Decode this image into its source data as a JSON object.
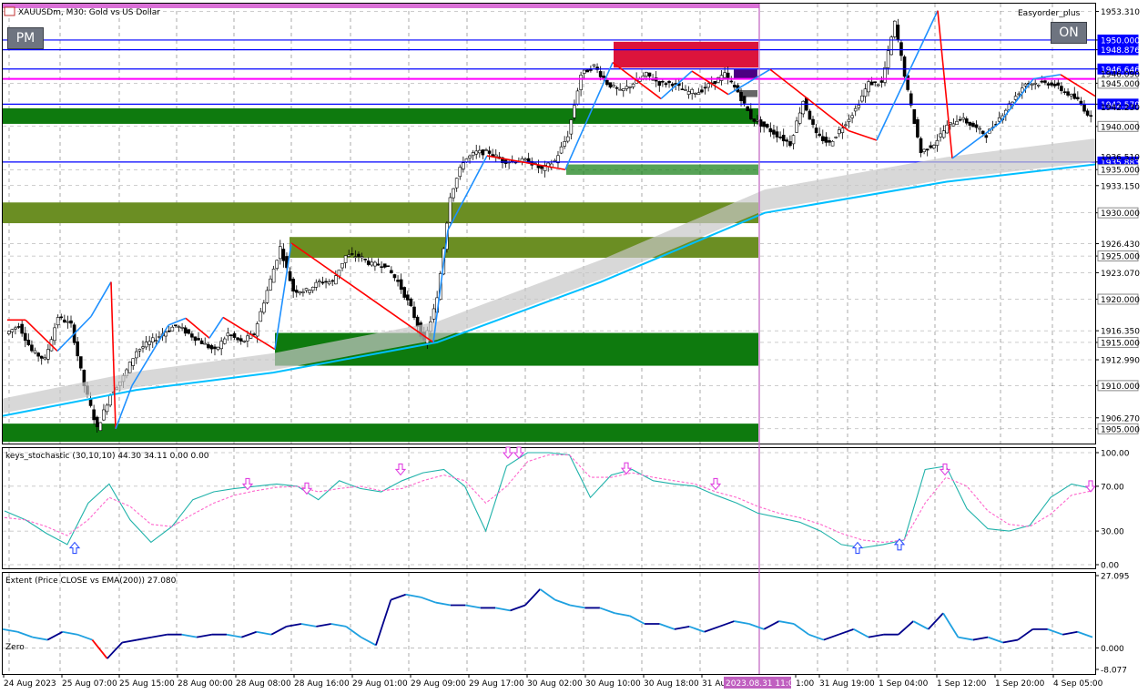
{
  "title": "XAUUSDm, M30:  Gold vs US Dollar",
  "expert_name": "Easyorder_plus",
  "buttons": {
    "pm": "PM",
    "on": "ON"
  },
  "colors": {
    "bull": "#0e7a0e",
    "olive": "#6b8e23",
    "supply": "#dc143c",
    "blue_line": "#0000ff",
    "magenta": "#ff00ff",
    "ema": "#00bfff",
    "zig_up": "#1e90ff",
    "zig_down": "#ff0000",
    "vline": "#c060c0"
  },
  "chart_data": [
    {
      "type": "candlestick",
      "title": "XAUUSDm, M30:  Gold vs US Dollar",
      "ylim": [
        1903.4,
        1954.0
      ],
      "price_ticks": [
        "1953.310",
        "1950.000",
        "1948.876",
        "1946.646",
        "1945.000",
        "1942.579",
        "1940.000",
        "1935.883",
        "1935.000",
        "1933.150",
        "1930.000",
        "1926.430",
        "1925.000",
        "1923.070",
        "1920.000",
        "1916.350",
        "1915.000",
        "1912.990",
        "1910.000",
        "1906.270",
        "1905.000"
      ],
      "partially_hidden_ticks": [
        "1946.090",
        "1942.230",
        "1936.510"
      ],
      "horizontal_lines": [
        1950.0,
        1948.876,
        1946.646,
        1945.5,
        1942.579,
        1935.883
      ],
      "x_labels": [
        "24 Aug 2023",
        "25 Aug 07:00",
        "25 Aug 15:00",
        "28 Aug 00:00",
        "28 Aug 08:00",
        "28 Aug 16:00",
        "29 Aug 01:00",
        "29 Aug 09:00",
        "29 Aug 17:00",
        "30 Aug 02:00",
        "30 Aug 10:00",
        "30 Aug 18:00",
        "31 Au",
        "2023.08.31 11:00",
        "1:00",
        "31 Aug 19:00",
        "1 Sep 04:00",
        "1 Sep 12:00",
        "1 Sep 20:00",
        "4 Sep 05:00"
      ],
      "zones": [
        {
          "kind": "demand",
          "from": 1940.3,
          "to": 1942.1
        },
        {
          "kind": "demand",
          "from": 1934.4,
          "to": 1935.6
        },
        {
          "kind": "olive",
          "from": 1928.8,
          "to": 1931.2
        },
        {
          "kind": "olive",
          "from": 1924.8,
          "to": 1927.2
        },
        {
          "kind": "demand",
          "from": 1912.3,
          "to": 1916.1
        },
        {
          "kind": "demand",
          "from": 1903.5,
          "to": 1905.6
        },
        {
          "kind": "supply",
          "from": 1946.8,
          "to": 1949.8
        }
      ],
      "close_path": [
        1916,
        1917,
        1914,
        1913,
        1918,
        1917,
        1910,
        1905,
        1909,
        1911,
        1914,
        1915,
        1916,
        1917,
        1916,
        1915,
        1914,
        1916,
        1915,
        1916,
        1921,
        1926,
        1921,
        1921,
        1922,
        1922,
        1925,
        1925,
        1924,
        1924,
        1922,
        1919,
        1915,
        1920,
        1932,
        1936,
        1937,
        1937,
        1936,
        1936,
        1936,
        1935,
        1936,
        1939,
        1946,
        1947,
        1945,
        1944,
        1945,
        1946,
        1945,
        1945,
        1944,
        1944,
        1945,
        1946,
        1944,
        1941,
        1940,
        1939,
        1938,
        1943,
        1939,
        1938,
        1940,
        1942,
        1945,
        1945,
        1952,
        1944,
        1937,
        1938,
        1940,
        1941,
        1940,
        1939,
        1941,
        1943,
        1945,
        1945,
        1945,
        1944,
        1943,
        1941
      ]
    },
    {
      "type": "line",
      "title": "keys_stochastic (30,10,10) 44.30 34.11 0.00 0.00",
      "ylim": [
        0,
        100
      ],
      "y_ticks": [
        "100.00",
        "70.00",
        "30.00",
        "0.00"
      ],
      "series": [
        {
          "values": [
            48,
            40,
            28,
            18,
            55,
            72,
            40,
            20,
            34,
            58,
            65,
            68,
            70,
            72,
            70,
            58,
            75,
            68,
            65,
            75,
            82,
            85,
            70,
            30,
            88,
            100,
            100,
            98,
            60,
            80,
            85,
            75,
            72,
            70,
            62,
            55,
            46,
            42,
            38,
            30,
            18,
            15,
            18,
            22,
            85,
            88,
            50,
            32,
            30,
            35,
            60,
            72,
            68
          ]
        },
        {
          "values": [
            42,
            40,
            34,
            26,
            40,
            60,
            52,
            36,
            34,
            45,
            55,
            62,
            66,
            69,
            70,
            65,
            68,
            70,
            66,
            68,
            75,
            80,
            75,
            55,
            70,
            92,
            98,
            98,
            78,
            78,
            82,
            78,
            75,
            72,
            65,
            60,
            52,
            46,
            42,
            36,
            28,
            22,
            20,
            22,
            55,
            78,
            70,
            48,
            36,
            34,
            45,
            62,
            66
          ]
        }
      ]
    },
    {
      "type": "line",
      "title": "Extent (Price CLOSE vs EMA(200)) 27.080",
      "ylim": [
        -8.077,
        27.095
      ],
      "y_ticks": [
        "27.095",
        "0.000",
        "-8.077"
      ],
      "zero_label": "Zero",
      "series": [
        {
          "values": [
            7,
            6,
            4,
            3,
            6,
            5,
            3,
            -4,
            2,
            3,
            4,
            5,
            5,
            4,
            5,
            5,
            4,
            6,
            5,
            8,
            9,
            8,
            9,
            8,
            4,
            1,
            18,
            20,
            19,
            17,
            16,
            16,
            15,
            15,
            14,
            16,
            22,
            18,
            16,
            15,
            15,
            13,
            12,
            9,
            9,
            7,
            8,
            6,
            8,
            10,
            9,
            7,
            10,
            9,
            5,
            3,
            5,
            7,
            4,
            5,
            5,
            10,
            7,
            13,
            4,
            3,
            4,
            2,
            3,
            7,
            7,
            5,
            6,
            4
          ]
        }
      ]
    }
  ]
}
